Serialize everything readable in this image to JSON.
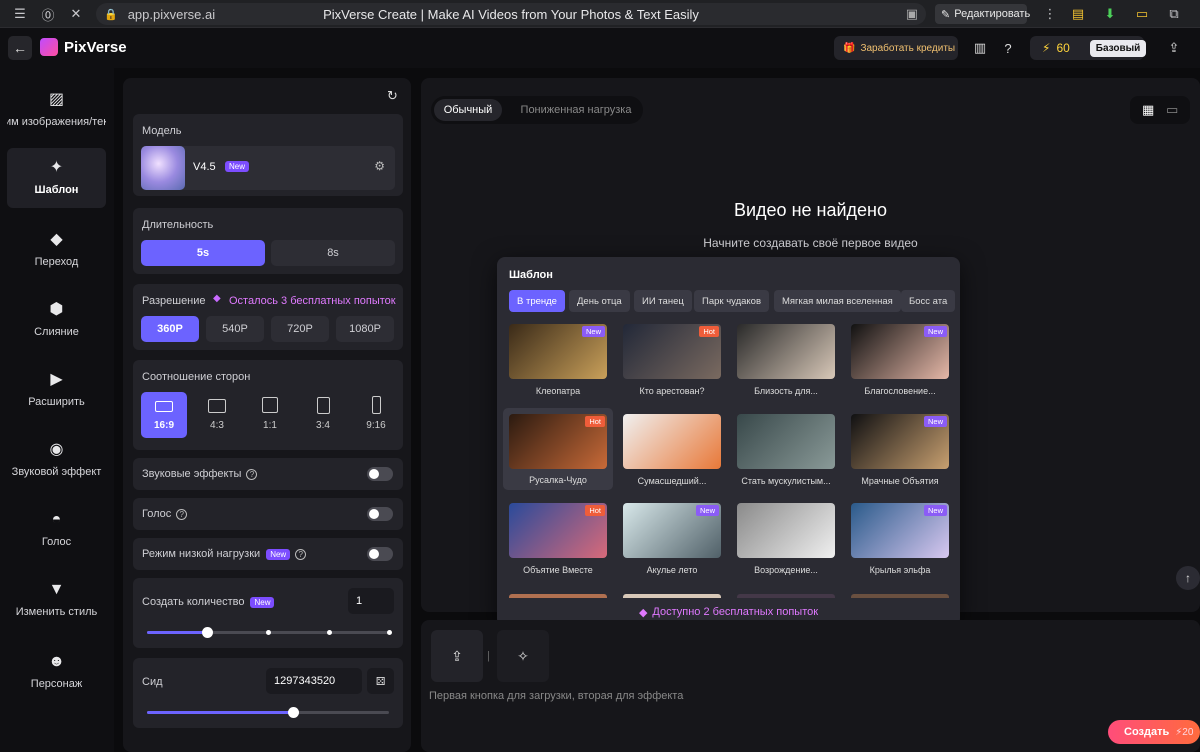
{
  "browser": {
    "url": "app.pixverse.ai",
    "title": "PixVerse Create | Make AI Videos from Your Photos & Text Easily",
    "edit_label": "Редактировать"
  },
  "header": {
    "brand": "PixVerse",
    "earn_label": "Заработать кредиты",
    "credits": "60",
    "plan": "Базовый"
  },
  "sidebar": {
    "items": [
      {
        "label": "им изображения/тек",
        "icon": "image-icon"
      },
      {
        "label": "Шаблон",
        "icon": "sparkle-icon",
        "active": true
      },
      {
        "label": "Переход",
        "icon": "transition-icon"
      },
      {
        "label": "Слияние",
        "icon": "cube-icon"
      },
      {
        "label": "Расширить",
        "icon": "extend-icon"
      },
      {
        "label": "Звуковой эффект",
        "icon": "sound-icon"
      },
      {
        "label": "Голос",
        "icon": "lips-icon"
      },
      {
        "label": "Изменить стиль",
        "icon": "brush-icon"
      },
      {
        "label": "Персонаж",
        "icon": "face-icon"
      }
    ]
  },
  "settings": {
    "model_label": "Модель",
    "model_name": "V4.5",
    "new_badge": "New",
    "duration_label": "Длительность",
    "durations": [
      "5s",
      "8s"
    ],
    "resolution_label": "Разрешение",
    "free_attempts": "Осталось 3 бесплатных попыток",
    "resolutions": [
      "360P",
      "540P",
      "720P",
      "1080P"
    ],
    "aspect_label": "Соотношение сторон",
    "aspects": [
      "16:9",
      "4:3",
      "1:1",
      "3:4",
      "9:16"
    ],
    "sound_label": "Звуковые эффекты",
    "voice_label": "Голос",
    "lowload_label": "Режим низкой нагрузки",
    "count_label": "Создать количество",
    "count_value": "1",
    "count_level": 1,
    "seed_label": "Сид",
    "seed_value": "1297343520"
  },
  "main": {
    "tabs": [
      "Обычный",
      "Пониженная нагрузка"
    ],
    "empty_title": "Видео не найдено",
    "empty_sub": "Начните создавать своё первое видео"
  },
  "popover": {
    "title": "Шаблон",
    "chips": [
      "В тренде",
      "День отца",
      "ИИ танец",
      "Парк чудаков",
      "Мягкая милая вселенная",
      "Босс ата"
    ],
    "templates": [
      {
        "name": "Клеопатра",
        "badge": "New",
        "colors": [
          "#3a2a18",
          "#c9a05a"
        ]
      },
      {
        "name": "Кто арестован?",
        "badge": "Hot",
        "colors": [
          "#222838",
          "#7a6a60"
        ]
      },
      {
        "name": "Близость для...",
        "badge": "",
        "colors": [
          "#2a2a2a",
          "#d8c8b8"
        ]
      },
      {
        "name": "Благословение...",
        "badge": "New",
        "colors": [
          "#111",
          "#e6b8a8"
        ]
      },
      {
        "name": "Русалка-Чудо",
        "badge": "Hot",
        "colors": [
          "#2b1a10",
          "#c86a38"
        ]
      },
      {
        "name": "Сумасшедший...",
        "badge": "",
        "colors": [
          "#f0f0f0",
          "#e87838"
        ]
      },
      {
        "name": "Стать мускулистым...",
        "badge": "",
        "colors": [
          "#38484a",
          "#8a9a98"
        ]
      },
      {
        "name": "Мрачные Объятия",
        "badge": "New",
        "colors": [
          "#101012",
          "#c8a070"
        ]
      },
      {
        "name": "Объятие Вместе",
        "badge": "Hot",
        "colors": [
          "#2a4a9a",
          "#d86a7a"
        ]
      },
      {
        "name": "Акулье лето",
        "badge": "New",
        "colors": [
          "#d8e8ea",
          "#506068"
        ]
      },
      {
        "name": "Возрождение...",
        "badge": "",
        "colors": [
          "#8a8a8a",
          "#f0f0f0"
        ]
      },
      {
        "name": "Крылья эльфа",
        "badge": "New",
        "colors": [
          "#2a5a8a",
          "#d8c8f0"
        ]
      }
    ],
    "footer": "Доступно 2 бесплатных попыток"
  },
  "bottom": {
    "prompt_placeholder": "Первая кнопка для загрузки, вторая для эффекта",
    "create_label": "Создать",
    "create_cost": "20"
  }
}
